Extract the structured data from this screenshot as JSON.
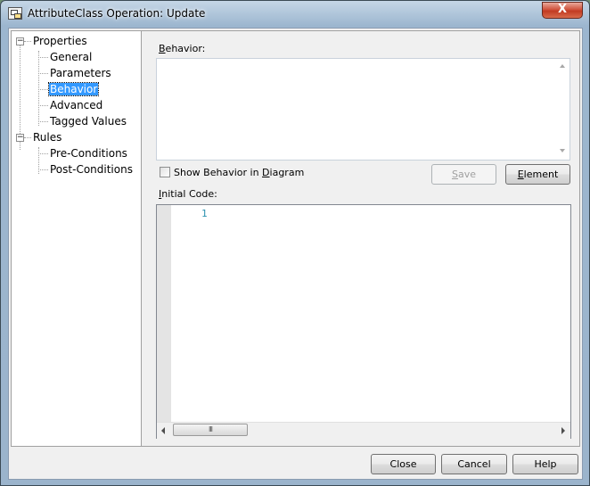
{
  "window": {
    "title": "AttributeClass Operation: Update",
    "close_glyph": "X"
  },
  "tree": {
    "groups": [
      {
        "label": "Properties",
        "expander": "−",
        "children": [
          "General",
          "Parameters",
          "Behavior",
          "Advanced",
          "Tagged Values"
        ]
      },
      {
        "label": "Rules",
        "expander": "−",
        "children": [
          "Pre-Conditions",
          "Post-Conditions"
        ]
      }
    ],
    "selected": "Behavior"
  },
  "behavior": {
    "label_first": "B",
    "label_rest": "ehavior:",
    "value": ""
  },
  "show_behavior": {
    "label_pre": "Show Behavior in ",
    "label_ul": "D",
    "label_post": "iagram",
    "checked": false
  },
  "buttons": {
    "save": {
      "ul": "S",
      "rest": "ave",
      "enabled": false
    },
    "element": {
      "ul": "E",
      "rest": "lement",
      "enabled": true
    }
  },
  "initial_code": {
    "label_first": "I",
    "label_rest": "nitial Code:",
    "line_numbers": [
      "1"
    ],
    "scroll_thumb_glyph": "III"
  },
  "footer": {
    "close": "Close",
    "cancel": "Cancel",
    "help": "Help"
  }
}
